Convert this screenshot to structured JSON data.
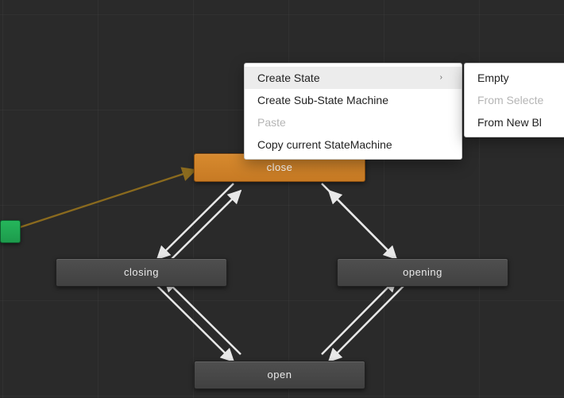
{
  "nodes": {
    "close": {
      "label": "close"
    },
    "closing": {
      "label": "closing"
    },
    "opening": {
      "label": "opening"
    },
    "open": {
      "label": "open"
    }
  },
  "context_menu": {
    "create_state": {
      "label": "Create State",
      "has_submenu": true
    },
    "create_sub_sm": {
      "label": "Create Sub-State Machine"
    },
    "paste": {
      "label": "Paste",
      "enabled": false
    },
    "copy_current": {
      "label": "Copy current StateMachine"
    }
  },
  "submenu": {
    "empty": {
      "label": "Empty"
    },
    "from_selected": {
      "label": "From Selecte",
      "enabled": false
    },
    "from_new_bt": {
      "label": "From New Bl"
    }
  },
  "colors": {
    "accent_orange": "#d78a2e",
    "entry_green": "#1d9a4c",
    "node_gray": "#4a4a4a"
  },
  "icons": {
    "chevron_right": "›"
  }
}
